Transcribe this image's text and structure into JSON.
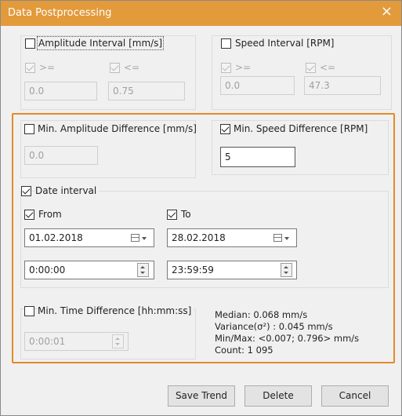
{
  "window": {
    "title": "Data Postprocessing",
    "close_icon": "×"
  },
  "amplitude_interval": {
    "label": "Amplitude Interval [mm/s]",
    "checked": false,
    "ge_label": ">=",
    "le_label": "<=",
    "ge_value": "0.0",
    "le_value": "0.75"
  },
  "speed_interval": {
    "label": "Speed Interval [RPM]",
    "checked": false,
    "ge_label": ">=",
    "le_label": "<=",
    "ge_value": "0.0",
    "le_value": "47.3"
  },
  "min_amplitude_difference": {
    "label": "Min. Amplitude Difference [mm/s]",
    "checked": false,
    "value": "0.0"
  },
  "min_speed_difference": {
    "label": "Min. Speed Difference [RPM]",
    "checked": true,
    "value": "5"
  },
  "date_interval": {
    "label": "Date interval",
    "checked": true,
    "from": {
      "label": "From",
      "checked": true,
      "date": "01.02.2018",
      "time": "0:00:00"
    },
    "to": {
      "label": "To",
      "checked": true,
      "date": "28.02.2018",
      "time": "23:59:59"
    }
  },
  "min_time_difference": {
    "label": "Min. Time Difference [hh:mm:ss]",
    "checked": false,
    "value": "0:00:01"
  },
  "statistics": {
    "median": "Median: 0.068 mm/s",
    "variance": "Variance(σ²) : 0.045 mm/s",
    "minmax": "Min/Max: <0.007; 0.796> mm/s",
    "count": "Count: 1 095"
  },
  "buttons": {
    "save_trend": "Save Trend",
    "delete": "Delete",
    "cancel": "Cancel"
  },
  "colors": {
    "title_bar": "#e39a3b",
    "highlight_border": "#e28a2a"
  }
}
